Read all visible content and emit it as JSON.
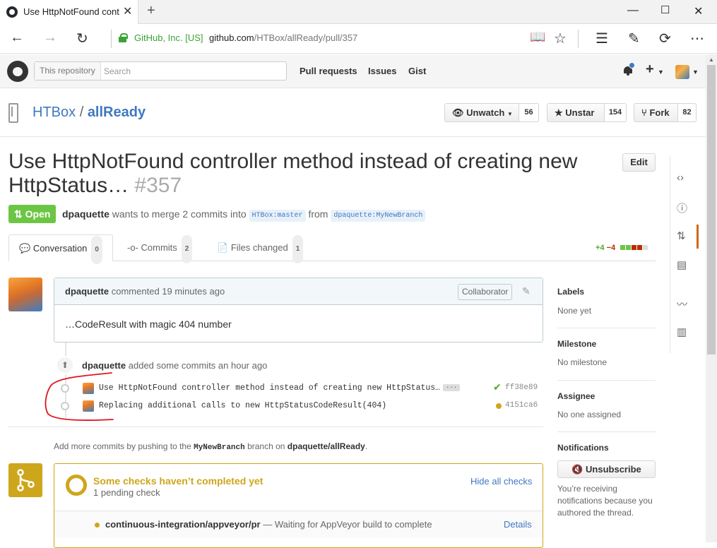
{
  "browser": {
    "tab_title": "Use HttpNotFound cont",
    "cert_label": "GitHub, Inc. [US]",
    "url_host": "github.com",
    "url_path": "/HTBox/allReady/pull/357"
  },
  "github": {
    "search_scope": "This repository",
    "search_placeholder": "Search",
    "nav": [
      "Pull requests",
      "Issues",
      "Gist"
    ]
  },
  "repo": {
    "owner": "HTBox",
    "name": "allReady",
    "watch_label": "Unwatch",
    "watch_count": "56",
    "star_label": "Unstar",
    "star_count": "154",
    "fork_label": "Fork",
    "fork_count": "82"
  },
  "pr": {
    "title": "Use HttpNotFound controller method instead of creating new HttpStatus…",
    "number": "#357",
    "edit_label": "Edit",
    "state": "Open",
    "author": "dpaquette",
    "merge_text": "wants to merge 2 commits into",
    "base_branch": "HTBox:master",
    "from_text": "from",
    "head_branch": "dpaquette:MyNewBranch",
    "tabs": [
      {
        "label": "Conversation",
        "count": "0"
      },
      {
        "label": "Commits",
        "count": "2"
      },
      {
        "label": "Files changed",
        "count": "1"
      }
    ],
    "additions": "+4",
    "deletions": "−4"
  },
  "comment": {
    "author": "dpaquette",
    "action": "commented 19 minutes ago",
    "badge": "Collaborator",
    "body": "…CodeResult with magic 404 number"
  },
  "commits_event": {
    "author": "dpaquette",
    "action": "added some commits an hour ago",
    "commits": [
      {
        "message": "Use HttpNotFound controller method instead of creating new HttpStatus…",
        "sha": "ff38e89",
        "status": "success"
      },
      {
        "message": "Replacing additional calls to new HttpStatusCodeResult(404)",
        "sha": "4151ca6",
        "status": "pending"
      }
    ]
  },
  "add_more": {
    "prefix": "Add more commits by pushing to the",
    "branch": "MyNewBranch",
    "mid": "branch on",
    "repo": "dpaquette/allReady",
    "suffix": "."
  },
  "checks": {
    "title": "Some checks haven’t completed yet",
    "subtitle": "1 pending check",
    "hide_label": "Hide all checks",
    "check_name": "continuous-integration/appveyor/pr",
    "check_status": "— Waiting for AppVeyor build to complete",
    "details_label": "Details"
  },
  "sidebar": {
    "labels_heading": "Labels",
    "labels_value": "None yet",
    "milestone_heading": "Milestone",
    "milestone_value": "No milestone",
    "assignee_heading": "Assignee",
    "assignee_value": "No one assigned",
    "notifications_heading": "Notifications",
    "unsubscribe_label": "Unsubscribe",
    "notifications_text": "You’re receiving notifications because you authored the thread."
  },
  "colors": {
    "open_green": "#6cc644",
    "link_blue": "#4078c0",
    "pending_yellow": "#cea61b",
    "annotation_red": "#e0141e"
  }
}
